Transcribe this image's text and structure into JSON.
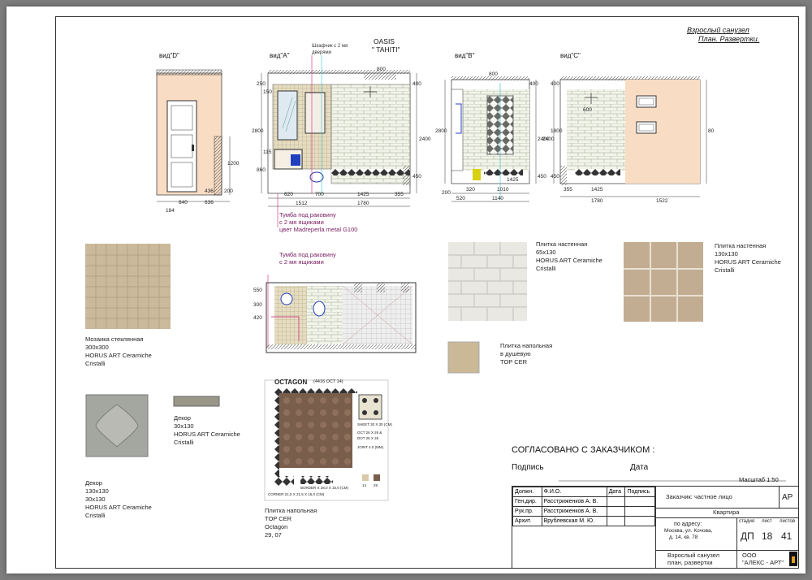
{
  "title": {
    "line1": "Взрослый санузел",
    "line2": "План. Развертки."
  },
  "views": {
    "d": "вид\"D\"",
    "a": "вид\"A\"",
    "b": "вид\"B\"",
    "c": "вид\"C\"",
    "oasis1": "OASIS",
    "oasis2": "\" TAHITI\"",
    "cabinet_note": "Шкафчик с 2 мя дверями"
  },
  "dims": {
    "d": [
      "840",
      "436",
      "636",
      "200",
      "184",
      "1200"
    ],
    "a": [
      "250",
      "150",
      "800",
      "620",
      "700",
      "1512",
      "1425",
      "1780",
      "355",
      "2800",
      "2400",
      "860",
      "115",
      "400",
      "450"
    ],
    "b": [
      "800",
      "400",
      "1010",
      "320",
      "520",
      "1140",
      "200",
      "1425",
      "2800",
      "2400",
      "450"
    ],
    "c": [
      "400",
      "600",
      "355",
      "1425",
      "1780",
      "1522",
      "2400",
      "1800",
      "450",
      "80"
    ]
  },
  "notes": {
    "vanity_a": [
      "Тумба под раковину",
      "с 2 мя ящиками",
      "цвет Madreperla metal G100"
    ],
    "vanity_plan": [
      "Тумба под раковину",
      "с 2 мя ящиками"
    ],
    "plan_dims": [
      "550",
      "300",
      "420"
    ]
  },
  "materials": [
    {
      "lines": [
        "Мозаика стеклянная",
        "300x300",
        "HORUS ART Ceramiche",
        "Cristalli"
      ],
      "color": "#c9b79a"
    },
    {
      "lines": [
        "Плитка настенная",
        "65x130",
        "HORUS ART Ceramiche",
        "Cristalli"
      ],
      "color": "#e8e6df"
    },
    {
      "lines": [
        "Плитка настенная",
        "130x130",
        "HORUS ART Ceramiche",
        "Cristalli"
      ],
      "color": "#c2ad92"
    },
    {
      "lines": [
        "Плитка напольная",
        "в душевую",
        "TOP CER"
      ],
      "color": "#cbb897"
    },
    {
      "lines": [
        "Декор",
        "30x130",
        "HORUS ART Ceramiche",
        "Cristalli"
      ],
      "color": "#9a9688"
    },
    {
      "lines": [
        "Декор",
        "130x130",
        "30x130",
        "HORUS ART Ceramiche",
        "Cristalli"
      ],
      "color": "#a4a6a0"
    },
    {
      "lines": [
        "Плитка напольная",
        "TOP CER",
        "Octagon",
        "29, 07"
      ],
      "color": "#7a5e4c"
    }
  ],
  "octagon": {
    "title": "OCTAGON",
    "code": "(4416 OCT 14)",
    "sheet": "SHEET 30 X 30 (CM)",
    "oct": "OCT 26 X 26 &",
    "dot": "DOT 26 X 26",
    "joint": "JOINT 4.0 (MM)",
    "border": "BORDER X 28,0 X 15,0 (CM)",
    "corner": "CORNER 21,5 X 21,5 X 15,0 (CM)",
    "c1": "14",
    "c2": "29"
  },
  "approval": {
    "title": "СОГЛАСОВАНО С ЗАКАЗЧИКОМ :",
    "signature": "Подпись",
    "date": "Дата",
    "scale": "Масштаб  1:50"
  },
  "stamp": {
    "rows": [
      [
        "Должн.",
        "Ф.И.О.",
        "Дата",
        "Подпись"
      ],
      [
        "Ген.дир.",
        "Расстриженков А. В.",
        "",
        ""
      ],
      [
        "Рук.пр.",
        "Расстриженков А. В.",
        "",
        ""
      ],
      [
        "Архит.",
        "Врублевская М. Ю.",
        "",
        ""
      ]
    ],
    "customer": "Заказчик:  частное лицо",
    "code": "АР",
    "object": "Квартира",
    "address": [
      "по адресу:",
      "Москва, ул. Кочова,",
      "д. 14, кв. 78"
    ],
    "stage_h": "стадия",
    "sheet_h": "лист",
    "sheets_h": "листов",
    "stage": "ДП",
    "sheet": "18",
    "sheets": "41",
    "drawing": [
      "Взрослый санузел",
      "план, развертки"
    ],
    "company": [
      "ООО",
      "\"АЛЕКС - АРТ\""
    ]
  }
}
